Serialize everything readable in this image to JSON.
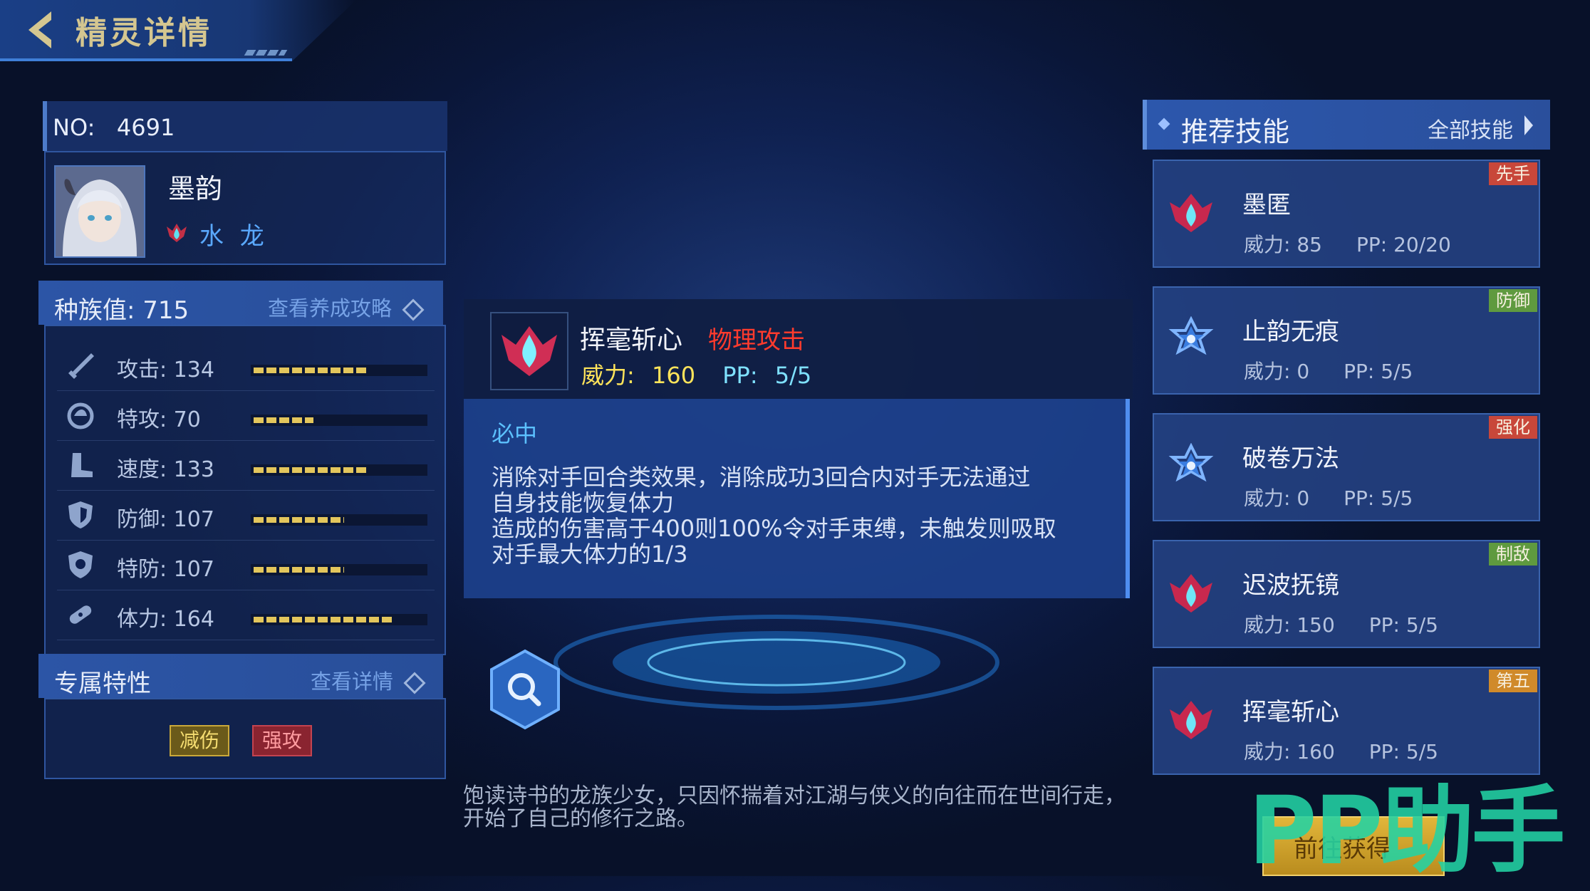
{
  "header": {
    "title": "精灵详情"
  },
  "pet": {
    "no_label": "NO:",
    "no_value": "4691",
    "name": "墨韵",
    "type": "水 龙",
    "type_icon": "water-dragon-emblem"
  },
  "stats": {
    "label": "种族值:",
    "total": "715",
    "guide_link": "查看养成攻略",
    "items": [
      {
        "name": "攻击:",
        "value": "134",
        "icon": "sword-icon",
        "fill": 0.67
      },
      {
        "name": "特攻:",
        "value": "70",
        "icon": "special-attack-icon",
        "fill": 0.35
      },
      {
        "name": "速度:",
        "value": "133",
        "icon": "boot-icon",
        "fill": 0.66
      },
      {
        "name": "防御:",
        "value": "107",
        "icon": "shield-icon",
        "fill": 0.53
      },
      {
        "name": "特防:",
        "value": "107",
        "icon": "special-shield-icon",
        "fill": 0.53
      },
      {
        "name": "体力:",
        "value": "164",
        "icon": "bandage-icon",
        "fill": 0.82
      }
    ]
  },
  "traits": {
    "label": "专属特性",
    "detail_link": "查看详情",
    "tags": [
      "减伤",
      "强攻"
    ]
  },
  "popup": {
    "skill_name": "挥毫斩心",
    "category": "物理攻击",
    "power_label": "威力:",
    "power_value": "160",
    "pp_label": "PP:",
    "pp_value": "5/5",
    "tag": "必中",
    "desc_lines": [
      "消除对手回合类效果，消除成功3回合内对手无法通过",
      "自身技能恢复体力",
      "造成的伤害高于400则100%令对手束缚，未触发则吸取",
      "对手最大体力的1/3"
    ]
  },
  "bottom_desc": "饱读诗书的龙族少女，只因怀揣着对江湖与侠义的向往而在世间行走，开始了自己的修行之路。",
  "recommend": {
    "title": "推荐技能",
    "all_link": "全部技能",
    "skills": [
      {
        "name": "墨匿",
        "power": "威力: 85",
        "pp": "PP:   20/20",
        "badge": "先手",
        "badge_color": "#c8473a",
        "icon": "water-drop-icon"
      },
      {
        "name": "止韵无痕",
        "power": "威力: 0",
        "pp": "PP:   5/5",
        "badge": "防御",
        "badge_color": "#5f9a3f",
        "icon": "star-emblem-icon"
      },
      {
        "name": "破卷万法",
        "power": "威力: 0",
        "pp": "PP:   5/5",
        "badge": "强化",
        "badge_color": "#c8473a",
        "icon": "star-emblem-icon"
      },
      {
        "name": "迟波抚镜",
        "power": "威力: 150",
        "pp": "PP:   5/5",
        "badge": "制敌",
        "badge_color": "#5f9a3f",
        "icon": "water-drop-icon"
      },
      {
        "name": "挥毫斩心",
        "power": "威力: 160",
        "pp": "PP:   5/5",
        "badge": "第五",
        "badge_color": "#d08a2a",
        "icon": "water-drop-icon"
      }
    ]
  },
  "get_button": "前往获得",
  "watermark": "PP助手"
}
